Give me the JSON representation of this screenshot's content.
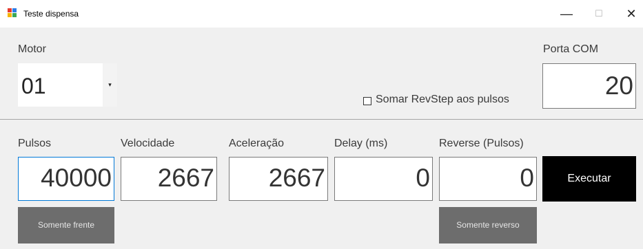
{
  "window": {
    "title": "Teste dispensa",
    "minimize_glyph": "—",
    "maximize_glyph": "☐",
    "close_glyph": "✕",
    "icon": "app-icon"
  },
  "motor": {
    "label": "Motor",
    "value": "01",
    "dropdown_glyph": "▾"
  },
  "somar_checkbox": {
    "label": "Somar RevStep aos pulsos",
    "checked": false
  },
  "porta_com": {
    "label": "Porta COM",
    "value": "20"
  },
  "fields": {
    "pulsos": {
      "label": "Pulsos",
      "value": "40000"
    },
    "velocidade": {
      "label": "Velocidade",
      "value": "2667"
    },
    "aceleracao": {
      "label": "Aceleração",
      "value": "2667"
    },
    "delay": {
      "label": "Delay (ms)",
      "value": "0"
    },
    "reverse": {
      "label": "Reverse (Pulsos)",
      "value": "0"
    }
  },
  "buttons": {
    "executar": "Executar",
    "somente_frente": "Somente frente",
    "somente_reverso": "Somente reverso"
  },
  "colors": {
    "focus_border": "#0078d7",
    "execute_bg": "#000000",
    "secondary_btn_bg": "#6d6d6d",
    "panel_bg": "#f0f0f0"
  }
}
